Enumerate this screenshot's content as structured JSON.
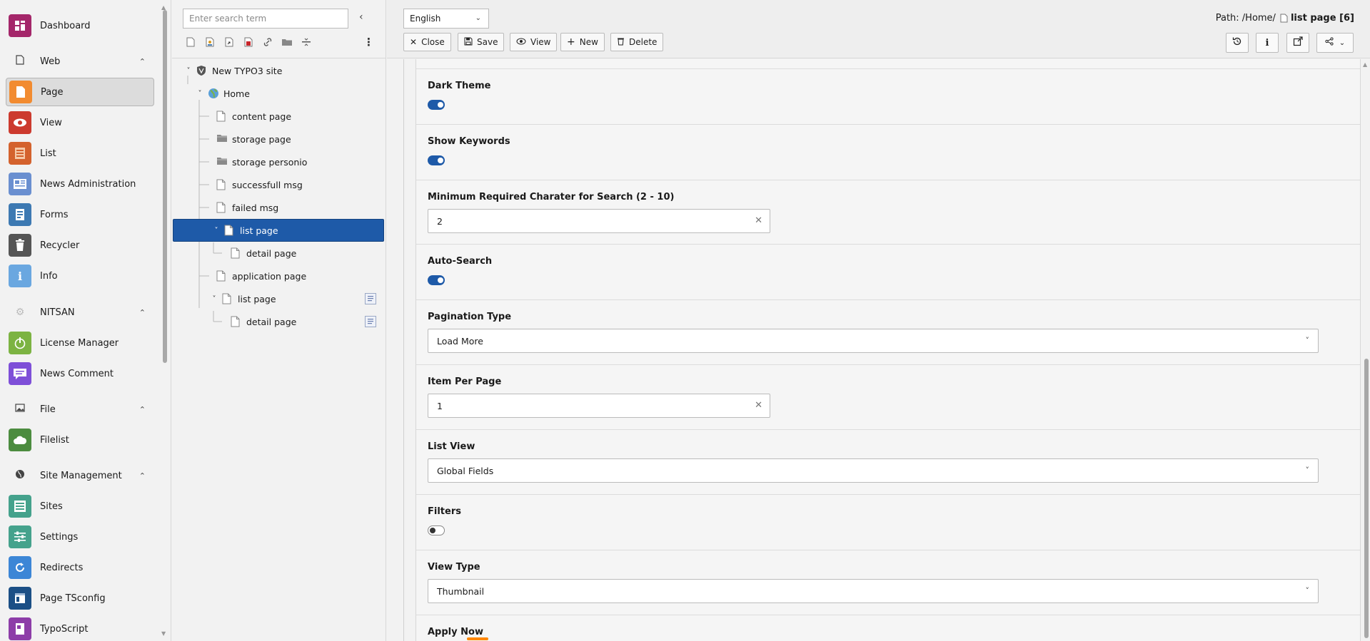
{
  "modulemenu": {
    "items": [
      {
        "type": "item",
        "label": "Dashboard",
        "icon": "dashboard-icon",
        "color": "#a4276a"
      },
      {
        "type": "group",
        "label": "Web",
        "icon": "document-icon"
      },
      {
        "type": "item",
        "label": "Page",
        "icon": "page-icon",
        "color": "#f28b30",
        "active": true
      },
      {
        "type": "item",
        "label": "View",
        "icon": "eye-icon",
        "color": "#cc3a2e"
      },
      {
        "type": "item",
        "label": "List",
        "icon": "list-icon",
        "color": "#d4622d"
      },
      {
        "type": "item",
        "label": "News Administration",
        "icon": "news-icon",
        "color": "#6a8fd0"
      },
      {
        "type": "item",
        "label": "Forms",
        "icon": "forms-icon",
        "color": "#3d79b2"
      },
      {
        "type": "item",
        "label": "Recycler",
        "icon": "trash-icon",
        "color": "#555555"
      },
      {
        "type": "item",
        "label": "Info",
        "icon": "info-icon",
        "color": "#6aa7e0"
      },
      {
        "type": "group",
        "label": "NITSAN",
        "icon": "gear-icon"
      },
      {
        "type": "item",
        "label": "License Manager",
        "icon": "power-icon",
        "color": "#7cb342"
      },
      {
        "type": "item",
        "label": "News Comment",
        "icon": "comment-icon",
        "color": "#7e4fd8"
      },
      {
        "type": "group",
        "label": "File",
        "icon": "image-icon"
      },
      {
        "type": "item",
        "label": "Filelist",
        "icon": "cloud-icon",
        "color": "#4c8c3f"
      },
      {
        "type": "group",
        "label": "Site Management",
        "icon": "globe-icon"
      },
      {
        "type": "item",
        "label": "Sites",
        "icon": "sites-icon",
        "color": "#45a28c"
      },
      {
        "type": "item",
        "label": "Settings",
        "icon": "sliders-icon",
        "color": "#45a28c"
      },
      {
        "type": "item",
        "label": "Redirects",
        "icon": "redirect-icon",
        "color": "#3c86d6"
      },
      {
        "type": "item",
        "label": "Page TSconfig",
        "icon": "tsconfig-icon",
        "color": "#1b4f86"
      },
      {
        "type": "item",
        "label": "TypoScript",
        "icon": "typoscript-icon",
        "color": "#8d3da8"
      }
    ]
  },
  "pagetree": {
    "search_placeholder": "Enter search term",
    "nodes": [
      {
        "label": "New TYPO3 site",
        "depth": 0,
        "toggle": "open",
        "icon": "typo3-site"
      },
      {
        "label": "Home",
        "depth": 1,
        "toggle": "open",
        "icon": "globe"
      },
      {
        "label": "content page",
        "depth": 2,
        "toggle": "",
        "icon": "page"
      },
      {
        "label": "storage page",
        "depth": 2,
        "toggle": "",
        "icon": "folder"
      },
      {
        "label": "storage personio",
        "depth": 2,
        "toggle": "",
        "icon": "folder"
      },
      {
        "label": "successfull msg",
        "depth": 2,
        "toggle": "",
        "icon": "page"
      },
      {
        "label": "failed msg",
        "depth": 2,
        "toggle": "",
        "icon": "page"
      },
      {
        "label": "list page",
        "depth": 2,
        "toggle": "open",
        "icon": "page",
        "selected": true
      },
      {
        "label": "detail page",
        "depth": 3,
        "toggle": "",
        "icon": "page"
      },
      {
        "label": "application page",
        "depth": 2,
        "toggle": "",
        "icon": "page"
      },
      {
        "label": "list page",
        "depth": 2,
        "toggle": "open",
        "icon": "page",
        "sideicon": true
      },
      {
        "label": "detail page",
        "depth": 3,
        "toggle": "",
        "icon": "page",
        "sideicon": true
      }
    ]
  },
  "docheader": {
    "language": "English",
    "path_prefix": "Path: /Home/",
    "path_title": "list page [6]",
    "buttons": {
      "close": "Close",
      "save": "Save",
      "view": "View",
      "new": "New",
      "delete": "Delete"
    }
  },
  "form": {
    "fields": [
      {
        "label": "Dark Theme",
        "kind": "toggle",
        "value": true
      },
      {
        "label": "Show Keywords",
        "kind": "toggle",
        "value": true
      },
      {
        "label": "Minimum Required Charater for Search (2 - 10)",
        "kind": "text",
        "value": "2"
      },
      {
        "label": "Auto-Search",
        "kind": "toggle",
        "value": true
      },
      {
        "label": "Pagination Type",
        "kind": "select",
        "value": "Load More"
      },
      {
        "label": "Item Per Page",
        "kind": "text",
        "value": "1"
      },
      {
        "label": "List View",
        "kind": "select",
        "value": "Global Fields"
      },
      {
        "label": "Filters",
        "kind": "toggle",
        "value": false
      },
      {
        "label": "View Type",
        "kind": "select",
        "value": "Thumbnail"
      },
      {
        "label": "Apply Now",
        "kind": "partial",
        "value": ""
      }
    ]
  },
  "colors": {
    "accent": "#1e5aa8",
    "background": "#f2f2f2"
  }
}
